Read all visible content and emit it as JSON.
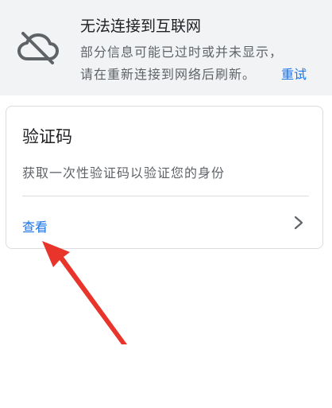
{
  "offline_banner": {
    "title": "无法连接到互联网",
    "message_line1": "部分信息可能已过时或并未显示，",
    "message_line2": "请在重新连接到网络后刷新。",
    "retry_label": "重试",
    "icon": "cloud-off-icon"
  },
  "card": {
    "title": "验证码",
    "description": "获取一次性验证码以验证您的身份",
    "action_label": "查看",
    "action_icon": "chevron-right-icon"
  },
  "colors": {
    "banner_background": "#f1f3f4",
    "link": "#1a73e8",
    "annotation_arrow": "#e8342b"
  }
}
